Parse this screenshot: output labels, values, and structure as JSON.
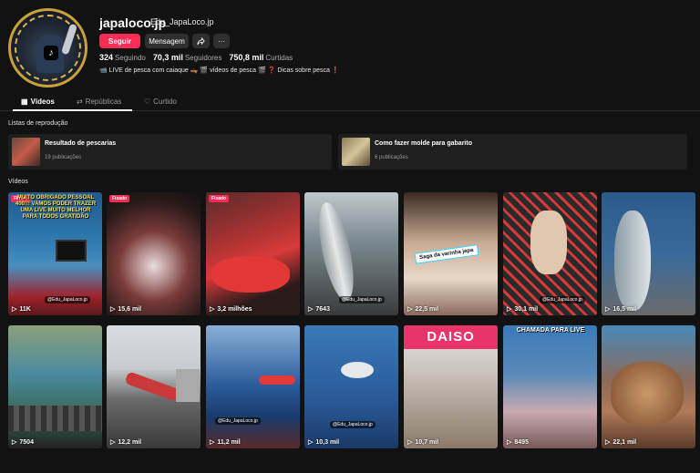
{
  "profile": {
    "username": "japaloco.jp",
    "nickname": "Edu_JapaLoco.jp",
    "follow_label": "Seguir",
    "message_label": "Mensagem",
    "share_icon": "share-icon",
    "more_label": "···",
    "following_count": "324",
    "following_label": "Seguindo",
    "followers_count": "70,3 mil",
    "followers_label": "Seguidores",
    "likes_count": "750,8 mil",
    "likes_label": "Curtidas",
    "bio": "📹 LIVE de pesca com caiaque 🛶 🎬 vídeos de pesca 🎬 ❓ Dicas sobre pesca ❗"
  },
  "tabs": [
    {
      "label": "Vídeos",
      "icon": "grid-icon"
    },
    {
      "label": "Repúblicas",
      "icon": "repost-icon"
    },
    {
      "label": "Curtido",
      "icon": "heart-icon"
    }
  ],
  "playlists_title": "Listas de reprodução",
  "playlists": [
    {
      "title": "Resultado de pescarias",
      "count": "19 publicações"
    },
    {
      "title": "Como fazer molde para gabarito",
      "count": "6 publicações"
    }
  ],
  "videos_title": "Vídeos",
  "pinned_label": "Fixado",
  "videos": [
    {
      "views": "11K",
      "caption": "MUITO OBRIGADO PESSOAL 400!!! VAMOS PODER TRAZER UMA LIVE MUITO MELHOR PARA TODOS GRATIDÃO",
      "stamp": "@Edu_JapaLoco.jp"
    },
    {
      "views": "15,6 mil"
    },
    {
      "views": "3,2 milhões"
    },
    {
      "views": "7643",
      "stamp": "@Edu_JapaLoco.jp"
    },
    {
      "views": "22,5 mil",
      "label": "Saga da varinha japa"
    },
    {
      "views": "30,1 mil",
      "stamp": "@Edu_JapaLoco.jp"
    },
    {
      "views": "16,5 mil"
    },
    {
      "views": "7504"
    },
    {
      "views": "12,2 mil"
    },
    {
      "views": "11,2 mil",
      "stamp": "@Edu_JapaLoco.jp"
    },
    {
      "views": "10,3 mil",
      "stamp": "@Edu_JapaLoco.jp"
    },
    {
      "views": "10,7 mil",
      "sign": "DAISO"
    },
    {
      "views": "8495",
      "caption": "CHAMADA PARA LIVE"
    },
    {
      "views": "22,1 mil"
    }
  ],
  "colors": {
    "accent": "#fe2c55",
    "background": "#121212",
    "surface": "#1f1f1f"
  }
}
